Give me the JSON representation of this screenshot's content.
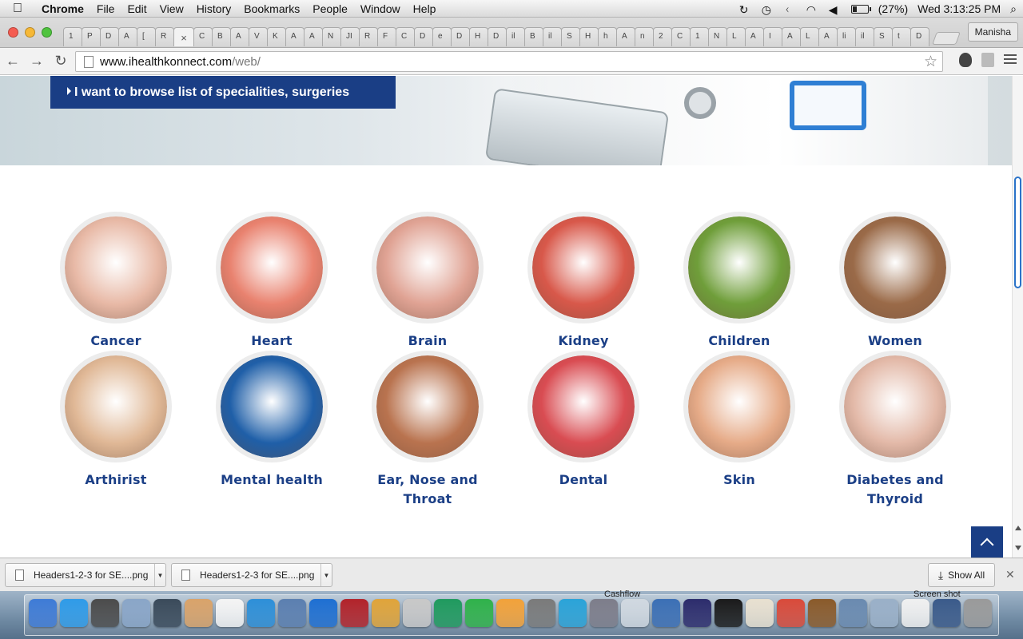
{
  "menubar": {
    "app_name": "Chrome",
    "menus": [
      "File",
      "Edit",
      "View",
      "History",
      "Bookmarks",
      "People",
      "Window",
      "Help"
    ],
    "battery": "(27%)",
    "clock": "Wed 3:13:25 PM"
  },
  "browser": {
    "tab_labels": [
      "1",
      "P",
      "D",
      "A",
      "[",
      "R",
      "×",
      "C",
      "B",
      "A",
      "V",
      "K",
      "A",
      "A",
      "N",
      "JI",
      "R",
      "F",
      "C",
      "D",
      "e",
      "D",
      "H",
      "D",
      "il",
      "B",
      "il",
      "S",
      "H",
      "h",
      "A",
      "n",
      "2",
      "C",
      "1",
      "N",
      "L",
      "A",
      "I",
      "A",
      "L",
      "A",
      "li",
      "il",
      "S",
      "t",
      "D"
    ],
    "profile": "Manisha",
    "url_domain": "www.ihealthkonnect.com",
    "url_path": "/web/"
  },
  "page": {
    "browse_button": "I want to browse list of specialities, surgeries",
    "specialities": [
      {
        "label": "Cancer",
        "icon": "smoking-man-icon",
        "color": "#e8b9a6"
      },
      {
        "label": "Heart",
        "icon": "heart-in-hands-icon",
        "color": "#e9826f"
      },
      {
        "label": "Brain",
        "icon": "brain-icon",
        "color": "#e0a394"
      },
      {
        "label": "Kidney",
        "icon": "kidney-icon",
        "color": "#d8584a"
      },
      {
        "label": "Children",
        "icon": "children-playing-icon",
        "color": "#6f9e3a"
      },
      {
        "label": "Women",
        "icon": "woman-portrait-icon",
        "color": "#9a6a48"
      },
      {
        "label": "Arthirist",
        "icon": "knee-hands-icon",
        "color": "#e0b896"
      },
      {
        "label": "Mental health",
        "icon": "head-brain-icon",
        "color": "#1f5fa8"
      },
      {
        "label": "Ear, Nose and Throat",
        "icon": "ent-anatomy-icon",
        "color": "#b9734f"
      },
      {
        "label": "Dental",
        "icon": "teeth-smile-icon",
        "color": "#d94c52"
      },
      {
        "label": "Skin",
        "icon": "face-skin-icon",
        "color": "#e6ab88"
      },
      {
        "label": "Diabetes and Thyroid",
        "icon": "glucose-meter-icon",
        "color": "#e3b9a8"
      }
    ]
  },
  "downloads": {
    "items": [
      "Headers1-2-3 for SE....png",
      "Headers1-2-3 for SE....png"
    ],
    "show_all": "Show All"
  },
  "dock": {
    "labels": [
      "Cashflow",
      "Screen shot"
    ]
  }
}
